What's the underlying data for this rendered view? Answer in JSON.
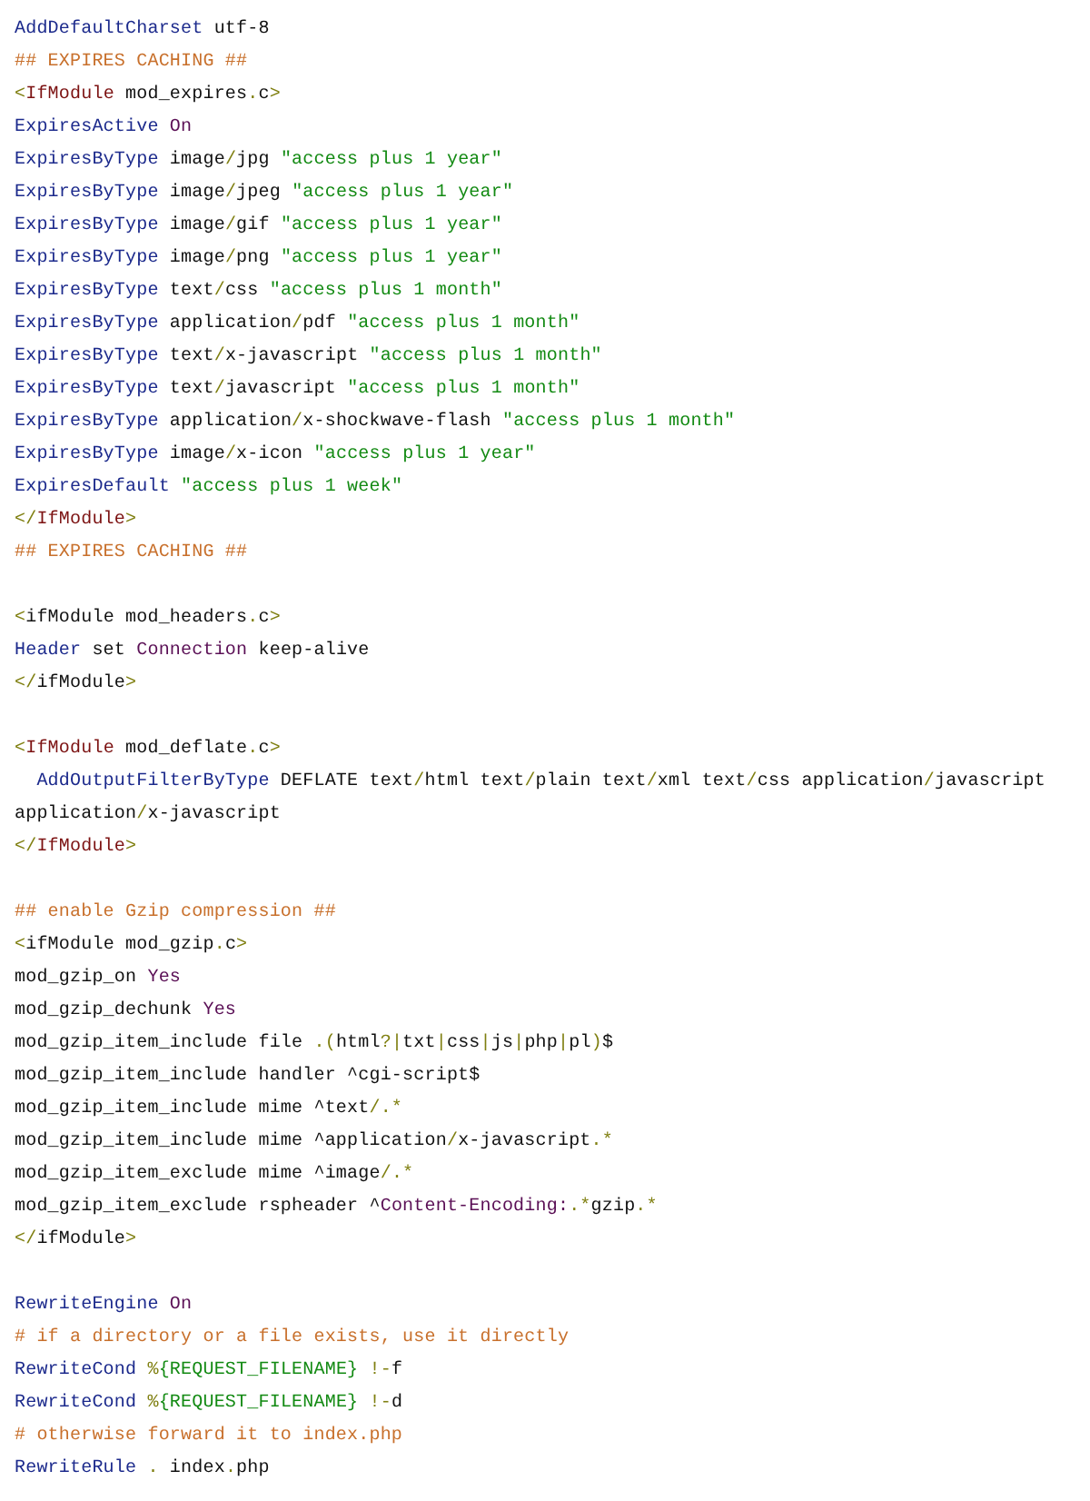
{
  "lines": [
    {
      "kind": "code",
      "tokens": [
        {
          "text": "AddDefaultCharset",
          "kind": "directive"
        },
        {
          "text": " utf-8",
          "kind": "plain"
        }
      ]
    },
    {
      "kind": "code",
      "tokens": [
        {
          "text": "## EXPIRES CACHING ##",
          "kind": "comment"
        }
      ]
    },
    {
      "kind": "code",
      "tokens": [
        {
          "text": "<",
          "kind": "punct"
        },
        {
          "text": "IfModule",
          "kind": "tag"
        },
        {
          "text": " mod_expires",
          "kind": "plain"
        },
        {
          "text": ".",
          "kind": "punct"
        },
        {
          "text": "c",
          "kind": "plain"
        },
        {
          "text": ">",
          "kind": "punct"
        }
      ]
    },
    {
      "kind": "code",
      "tokens": [
        {
          "text": "ExpiresActive",
          "kind": "directive"
        },
        {
          "text": " On",
          "kind": "keyword"
        }
      ]
    },
    {
      "kind": "code",
      "tokens": [
        {
          "text": "ExpiresByType",
          "kind": "directive"
        },
        {
          "text": " image",
          "kind": "plain"
        },
        {
          "text": "/",
          "kind": "punct"
        },
        {
          "text": "jpg ",
          "kind": "plain"
        },
        {
          "text": "\"access plus 1 year\"",
          "kind": "string"
        }
      ]
    },
    {
      "kind": "code",
      "tokens": [
        {
          "text": "ExpiresByType",
          "kind": "directive"
        },
        {
          "text": " image",
          "kind": "plain"
        },
        {
          "text": "/",
          "kind": "punct"
        },
        {
          "text": "jpeg ",
          "kind": "plain"
        },
        {
          "text": "\"access plus 1 year\"",
          "kind": "string"
        }
      ]
    },
    {
      "kind": "code",
      "tokens": [
        {
          "text": "ExpiresByType",
          "kind": "directive"
        },
        {
          "text": " image",
          "kind": "plain"
        },
        {
          "text": "/",
          "kind": "punct"
        },
        {
          "text": "gif ",
          "kind": "plain"
        },
        {
          "text": "\"access plus 1 year\"",
          "kind": "string"
        }
      ]
    },
    {
      "kind": "code",
      "tokens": [
        {
          "text": "ExpiresByType",
          "kind": "directive"
        },
        {
          "text": " image",
          "kind": "plain"
        },
        {
          "text": "/",
          "kind": "punct"
        },
        {
          "text": "png ",
          "kind": "plain"
        },
        {
          "text": "\"access plus 1 year\"",
          "kind": "string"
        }
      ]
    },
    {
      "kind": "code",
      "tokens": [
        {
          "text": "ExpiresByType",
          "kind": "directive"
        },
        {
          "text": " text",
          "kind": "plain"
        },
        {
          "text": "/",
          "kind": "punct"
        },
        {
          "text": "css ",
          "kind": "plain"
        },
        {
          "text": "\"access plus 1 month\"",
          "kind": "string"
        }
      ]
    },
    {
      "kind": "code",
      "tokens": [
        {
          "text": "ExpiresByType",
          "kind": "directive"
        },
        {
          "text": " application",
          "kind": "plain"
        },
        {
          "text": "/",
          "kind": "punct"
        },
        {
          "text": "pdf ",
          "kind": "plain"
        },
        {
          "text": "\"access plus 1 month\"",
          "kind": "string"
        }
      ]
    },
    {
      "kind": "code",
      "tokens": [
        {
          "text": "ExpiresByType",
          "kind": "directive"
        },
        {
          "text": " text",
          "kind": "plain"
        },
        {
          "text": "/",
          "kind": "punct"
        },
        {
          "text": "x-javascript ",
          "kind": "plain"
        },
        {
          "text": "\"access plus 1 month\"",
          "kind": "string"
        }
      ]
    },
    {
      "kind": "code",
      "tokens": [
        {
          "text": "ExpiresByType",
          "kind": "directive"
        },
        {
          "text": " text",
          "kind": "plain"
        },
        {
          "text": "/",
          "kind": "punct"
        },
        {
          "text": "javascript ",
          "kind": "plain"
        },
        {
          "text": "\"access plus 1 month\"",
          "kind": "string"
        }
      ]
    },
    {
      "kind": "code",
      "tokens": [
        {
          "text": "ExpiresByType",
          "kind": "directive"
        },
        {
          "text": " application",
          "kind": "plain"
        },
        {
          "text": "/",
          "kind": "punct"
        },
        {
          "text": "x-shockwave-flash ",
          "kind": "plain"
        },
        {
          "text": "\"access plus 1 month\"",
          "kind": "string"
        }
      ]
    },
    {
      "kind": "code",
      "tokens": [
        {
          "text": "ExpiresByType",
          "kind": "directive"
        },
        {
          "text": " image",
          "kind": "plain"
        },
        {
          "text": "/",
          "kind": "punct"
        },
        {
          "text": "x-icon ",
          "kind": "plain"
        },
        {
          "text": "\"access plus 1 year\"",
          "kind": "string"
        }
      ]
    },
    {
      "kind": "code",
      "tokens": [
        {
          "text": "ExpiresDefault",
          "kind": "directive"
        },
        {
          "text": " \"access plus 1 week\"",
          "kind": "string"
        }
      ]
    },
    {
      "kind": "code",
      "tokens": [
        {
          "text": "</",
          "kind": "punct"
        },
        {
          "text": "IfModule",
          "kind": "tag"
        },
        {
          "text": ">",
          "kind": "punct"
        }
      ]
    },
    {
      "kind": "code",
      "tokens": [
        {
          "text": "## EXPIRES CACHING ##",
          "kind": "comment"
        }
      ]
    },
    {
      "kind": "blank"
    },
    {
      "kind": "code",
      "tokens": [
        {
          "text": "<",
          "kind": "punct"
        },
        {
          "text": "ifModule mod_headers",
          "kind": "plain"
        },
        {
          "text": ".",
          "kind": "punct"
        },
        {
          "text": "c",
          "kind": "plain"
        },
        {
          "text": ">",
          "kind": "punct"
        }
      ]
    },
    {
      "kind": "code",
      "tokens": [
        {
          "text": "Header",
          "kind": "directive"
        },
        {
          "text": " set ",
          "kind": "plain"
        },
        {
          "text": "Connection",
          "kind": "keyword"
        },
        {
          "text": " keep-alive",
          "kind": "plain"
        }
      ]
    },
    {
      "kind": "code",
      "tokens": [
        {
          "text": "</",
          "kind": "punct"
        },
        {
          "text": "ifModule",
          "kind": "plain"
        },
        {
          "text": ">",
          "kind": "punct"
        }
      ]
    },
    {
      "kind": "blank"
    },
    {
      "kind": "code",
      "tokens": [
        {
          "text": "<",
          "kind": "punct"
        },
        {
          "text": "IfModule",
          "kind": "tag"
        },
        {
          "text": " mod_deflate",
          "kind": "plain"
        },
        {
          "text": ".",
          "kind": "punct"
        },
        {
          "text": "c",
          "kind": "plain"
        },
        {
          "text": ">",
          "kind": "punct"
        }
      ]
    },
    {
      "kind": "code",
      "tokens": [
        {
          "text": "  AddOutputFilterByType",
          "kind": "directive"
        },
        {
          "text": " DEFLATE text",
          "kind": "plain"
        },
        {
          "text": "/",
          "kind": "punct"
        },
        {
          "text": "html text",
          "kind": "plain"
        },
        {
          "text": "/",
          "kind": "punct"
        },
        {
          "text": "plain text",
          "kind": "plain"
        },
        {
          "text": "/",
          "kind": "punct"
        },
        {
          "text": "xml text",
          "kind": "plain"
        },
        {
          "text": "/",
          "kind": "punct"
        },
        {
          "text": "css application",
          "kind": "plain"
        },
        {
          "text": "/",
          "kind": "punct"
        },
        {
          "text": "javascript",
          "kind": "plain"
        }
      ]
    },
    {
      "kind": "code",
      "tokens": [
        {
          "text": "application",
          "kind": "plain"
        },
        {
          "text": "/",
          "kind": "punct"
        },
        {
          "text": "x-javascript",
          "kind": "plain"
        }
      ]
    },
    {
      "kind": "code",
      "tokens": [
        {
          "text": "</",
          "kind": "punct"
        },
        {
          "text": "IfModule",
          "kind": "tag"
        },
        {
          "text": ">",
          "kind": "punct"
        }
      ]
    },
    {
      "kind": "blank"
    },
    {
      "kind": "code",
      "tokens": [
        {
          "text": "## enable Gzip compression ##",
          "kind": "comment"
        }
      ]
    },
    {
      "kind": "code",
      "tokens": [
        {
          "text": "<",
          "kind": "punct"
        },
        {
          "text": "ifModule mod_gzip",
          "kind": "plain"
        },
        {
          "text": ".",
          "kind": "punct"
        },
        {
          "text": "c",
          "kind": "plain"
        },
        {
          "text": ">",
          "kind": "punct"
        }
      ]
    },
    {
      "kind": "code",
      "tokens": [
        {
          "text": "mod_gzip_on ",
          "kind": "plain"
        },
        {
          "text": "Yes",
          "kind": "keyword"
        }
      ]
    },
    {
      "kind": "code",
      "tokens": [
        {
          "text": "mod_gzip_dechunk ",
          "kind": "plain"
        },
        {
          "text": "Yes",
          "kind": "keyword"
        }
      ]
    },
    {
      "kind": "code",
      "tokens": [
        {
          "text": "mod_gzip_item_include file ",
          "kind": "plain"
        },
        {
          "text": ".(",
          "kind": "punct"
        },
        {
          "text": "html",
          "kind": "plain"
        },
        {
          "text": "?|",
          "kind": "punct"
        },
        {
          "text": "txt",
          "kind": "plain"
        },
        {
          "text": "|",
          "kind": "punct"
        },
        {
          "text": "css",
          "kind": "plain"
        },
        {
          "text": "|",
          "kind": "punct"
        },
        {
          "text": "js",
          "kind": "plain"
        },
        {
          "text": "|",
          "kind": "punct"
        },
        {
          "text": "php",
          "kind": "plain"
        },
        {
          "text": "|",
          "kind": "punct"
        },
        {
          "text": "pl",
          "kind": "plain"
        },
        {
          "text": ")",
          "kind": "punct"
        },
        {
          "text": "$",
          "kind": "plain"
        }
      ]
    },
    {
      "kind": "code",
      "tokens": [
        {
          "text": "mod_gzip_item_include handler ^cgi-script$",
          "kind": "plain"
        }
      ]
    },
    {
      "kind": "code",
      "tokens": [
        {
          "text": "mod_gzip_item_include mime ^text",
          "kind": "plain"
        },
        {
          "text": "/.*",
          "kind": "punct"
        }
      ]
    },
    {
      "kind": "code",
      "tokens": [
        {
          "text": "mod_gzip_item_include mime ^application",
          "kind": "plain"
        },
        {
          "text": "/",
          "kind": "punct"
        },
        {
          "text": "x-javascript",
          "kind": "plain"
        },
        {
          "text": ".*",
          "kind": "punct"
        }
      ]
    },
    {
      "kind": "code",
      "tokens": [
        {
          "text": "mod_gzip_item_exclude mime ^image",
          "kind": "plain"
        },
        {
          "text": "/.*",
          "kind": "punct"
        }
      ]
    },
    {
      "kind": "code",
      "tokens": [
        {
          "text": "mod_gzip_item_exclude rspheader ^",
          "kind": "plain"
        },
        {
          "text": "Content-Encoding:",
          "kind": "keyword"
        },
        {
          "text": ".*",
          "kind": "punct"
        },
        {
          "text": "gzip",
          "kind": "plain"
        },
        {
          "text": ".*",
          "kind": "punct"
        }
      ]
    },
    {
      "kind": "code",
      "tokens": [
        {
          "text": "</",
          "kind": "punct"
        },
        {
          "text": "ifModule",
          "kind": "plain"
        },
        {
          "text": ">",
          "kind": "punct"
        }
      ]
    },
    {
      "kind": "blank"
    },
    {
      "kind": "code",
      "tokens": [
        {
          "text": "RewriteEngine",
          "kind": "directive"
        },
        {
          "text": " On",
          "kind": "keyword"
        }
      ]
    },
    {
      "kind": "code",
      "tokens": [
        {
          "text": "# if a directory or a file exists, use it directly",
          "kind": "comment"
        }
      ]
    },
    {
      "kind": "code",
      "tokens": [
        {
          "text": "RewriteCond",
          "kind": "directive"
        },
        {
          "text": " %",
          "kind": "punct"
        },
        {
          "text": "{REQUEST_FILENAME}",
          "kind": "string"
        },
        {
          "text": " !-",
          "kind": "punct"
        },
        {
          "text": "f",
          "kind": "plain"
        }
      ]
    },
    {
      "kind": "code",
      "tokens": [
        {
          "text": "RewriteCond",
          "kind": "directive"
        },
        {
          "text": " %",
          "kind": "punct"
        },
        {
          "text": "{REQUEST_FILENAME}",
          "kind": "string"
        },
        {
          "text": " !-",
          "kind": "punct"
        },
        {
          "text": "d",
          "kind": "plain"
        }
      ]
    },
    {
      "kind": "code",
      "tokens": [
        {
          "text": "# otherwise forward it to index.php",
          "kind": "comment"
        }
      ]
    },
    {
      "kind": "code",
      "tokens": [
        {
          "text": "RewriteRule",
          "kind": "directive"
        },
        {
          "text": " .",
          "kind": "punct"
        },
        {
          "text": " index",
          "kind": "plain"
        },
        {
          "text": ".",
          "kind": "punct"
        },
        {
          "text": "php",
          "kind": "plain"
        }
      ]
    }
  ]
}
